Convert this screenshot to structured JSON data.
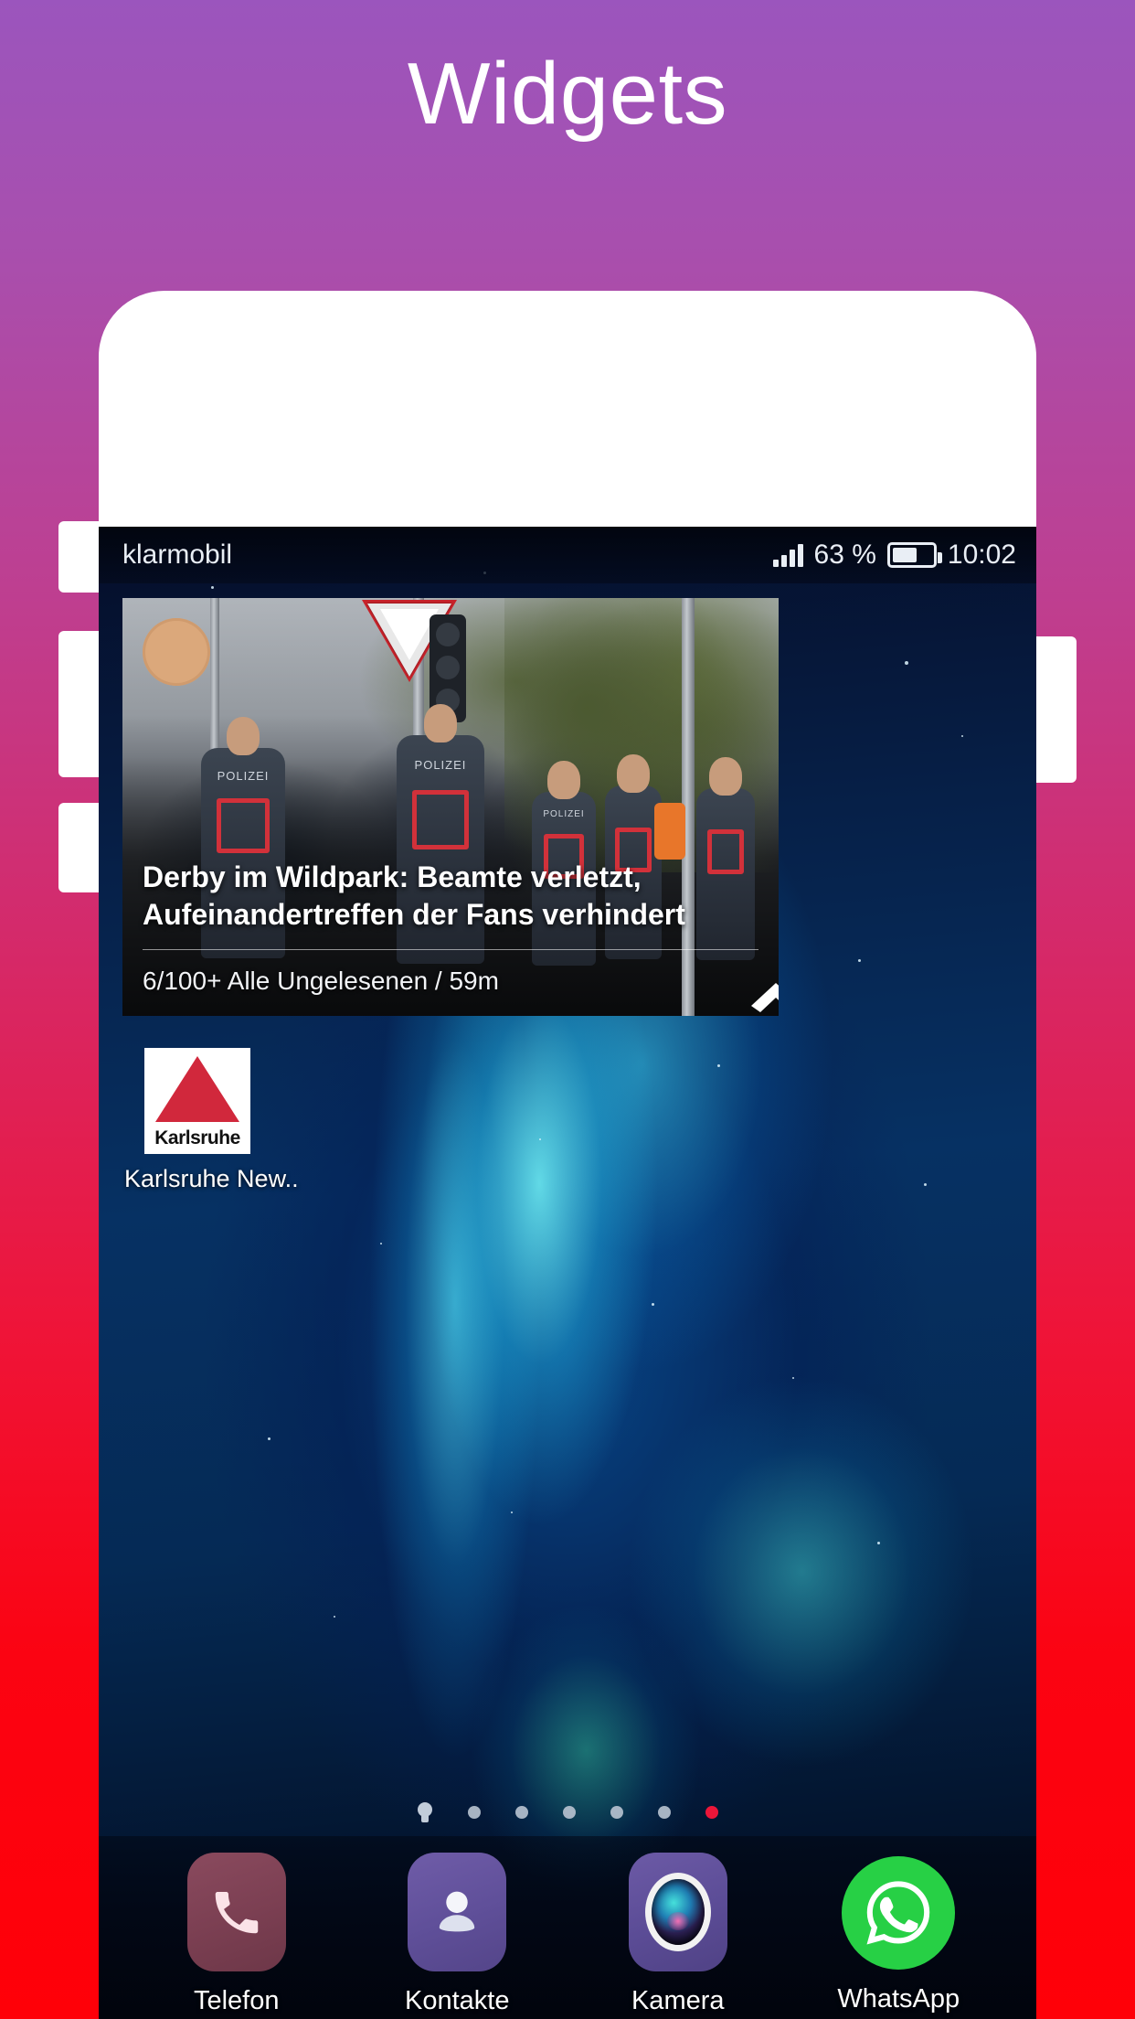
{
  "page": {
    "title": "Widgets"
  },
  "theme": {
    "gradient_top": "#9b55bd",
    "gradient_bottom": "#ff0008",
    "title_color": "#ffffff",
    "phone_frame_color": "#ffffff",
    "active_dot_color": "#ec1639",
    "karlsruhe_red": "#d1283c",
    "whatsapp_green": "#27d045"
  },
  "statusbar": {
    "carrier": "klarmobil",
    "signal_icon": "signal-bars-icon",
    "battery_percent": "63 %",
    "battery_level": 63,
    "battery_icon": "battery-icon",
    "clock": "10:02"
  },
  "news_widget": {
    "headline": "Derby im Wildpark: Beamte verletzt, Aufeinandertreffen der Fans verhindert",
    "meta": "6/100+  Alle Ungelesenen / 59m",
    "counter": "6/100+",
    "filter": "Alle Ungelesenen",
    "age": "59m",
    "collapse_icon": "chevron-up-icon",
    "photo_alt_tags": [
      "POLIZEI",
      "POLIZEI",
      "POLIZEI"
    ]
  },
  "homescreen": {
    "apps": [
      {
        "label": "Karlsruhe New..",
        "icon": "karlsruhe-app-icon",
        "icon_word": "Karlsruhe"
      }
    ],
    "page_dots": [
      {
        "type": "bulb",
        "active": false
      },
      {
        "type": "dot",
        "active": false
      },
      {
        "type": "dot",
        "active": false
      },
      {
        "type": "dot",
        "active": false
      },
      {
        "type": "dot",
        "active": false
      },
      {
        "type": "dot",
        "active": false
      },
      {
        "type": "dot",
        "active": true
      }
    ]
  },
  "dock": {
    "items": [
      {
        "label": "Telefon",
        "icon": "phone-icon"
      },
      {
        "label": "Kontakte",
        "icon": "contacts-icon"
      },
      {
        "label": "Kamera",
        "icon": "camera-icon"
      },
      {
        "label": "WhatsApp",
        "icon": "whatsapp-icon"
      }
    ]
  }
}
